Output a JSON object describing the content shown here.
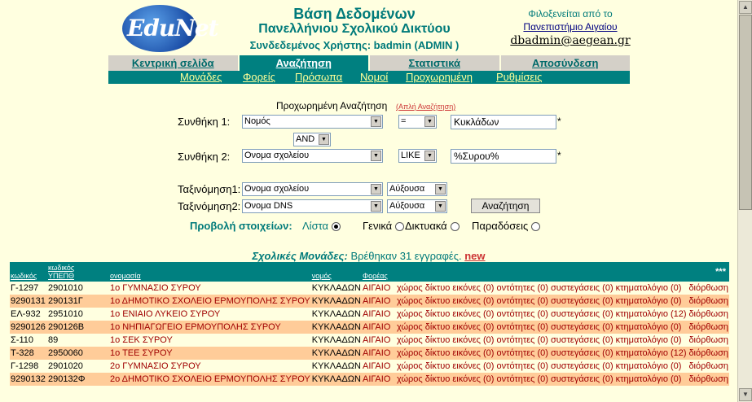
{
  "header": {
    "logo_text": "EduNet",
    "title_line1": "Βάση Δεδομένων",
    "title_line2": "Πανελλήνιου Σχολικού Δικτύου",
    "user_line": "Συνδεδεμένος Χρήστης: badmin (ADMIN )",
    "host_label": "Φιλοξενείται από το",
    "host_org": "Πανεπιστήμιο Αιγαίου",
    "host_email": "dbadmin@aegean.gr"
  },
  "nav": {
    "tabs": [
      "Κεντρική σελίδα",
      "Αναζήτηση",
      "Στατιστικά",
      "Αποσύνδεση"
    ],
    "subitems": [
      "Μονάδες",
      "Φορείς",
      "Πρόσωπα",
      "Νομοί",
      "Προχωρημένη",
      "Ρυθμίσεις"
    ]
  },
  "search": {
    "title": "Προχωρημένη Αναζήτηση",
    "simple_link": "(Απλή Αναζήτηση)",
    "cond1_label": "Συνθήκη 1:",
    "cond1_field": "Νομός",
    "cond1_op": "=",
    "cond1_value": "Κυκλάδων",
    "joiner": "AND",
    "cond2_label": "Συνθήκη 2:",
    "cond2_field": "Ονομα σχολείου",
    "cond2_op": "LIKE",
    "cond2_value": "%Συρου%",
    "star": "*",
    "sort1_label": "Ταξινόμηση1:",
    "sort1_field": "Ονομα σχολείου",
    "sort1_dir": "Αύξουσα",
    "sort2_label": "Ταξινόμηση2:",
    "sort2_field": "Ονομα DNS",
    "sort2_dir": "Αύξουσα",
    "button": "Αναζήτηση",
    "view_label": "Προβολή στοιχείων:",
    "view_options": [
      "Λίστα",
      "Γενικά",
      "Δικτυακά",
      "Παραδόσεις"
    ],
    "view_selected": "Λίστα"
  },
  "results": {
    "title": "Σχολικές Μονάδες:",
    "count_text": "Βρέθηκαν 31 εγγραφές.",
    "new_link": "new"
  },
  "table": {
    "headers": {
      "code": "κωδικός",
      "ypepth_line1": "κωδικός",
      "ypepth_line2": "ΥΠΕΠΘ",
      "name": "ονομασία",
      "nomos": "νομός",
      "foreas": "Φορέας",
      "stars": "***"
    },
    "rows": [
      {
        "code": "Γ-1297",
        "ypepth": "2901010",
        "name": "1ο ΓΥΜΝΑΣΙΟ ΣΥΡΟΥ",
        "nomos": "ΚΥΚΛΑΔΩΝ",
        "foreas": "ΑΙΓΑΙΟ",
        "links": "χώρος δίκτυο εικόνες (0) οντότητες (0) συστεγάσεις (0) κτηματολόγιο (0)",
        "edit": "διόρθωση"
      },
      {
        "code": "9290131",
        "ypepth": "290131Γ",
        "name": "1ο ΔΗΜΟΤΙΚΟ ΣΧΟΛΕΙΟ ΕΡΜΟΥΠΟΛΗΣ ΣΥΡΟΥ",
        "nomos": "ΚΥΚΛΑΔΩΝ",
        "foreas": "ΑΙΓΑΙΟ",
        "links": "χώρος δίκτυο εικόνες (0) οντότητες (0) συστεγάσεις (0) κτηματολόγιο (0)",
        "edit": "διόρθωση"
      },
      {
        "code": "ΕΛ-932",
        "ypepth": "2951010",
        "name": "1ο ΕΝΙΑΙΟ ΛΥΚΕΙΟ ΣΥΡΟΥ",
        "nomos": "ΚΥΚΛΑΔΩΝ",
        "foreas": "ΑΙΓΑΙΟ",
        "links": "χώρος δίκτυο εικόνες (0) οντότητες (0) συστεγάσεις (0) κτηματολόγιο (12)",
        "edit": "διόρθωση"
      },
      {
        "code": "9290126",
        "ypepth": "290126Β",
        "name": "1ο ΝΗΠΙΑΓΩΓΕΙΟ ΕΡΜΟΥΠΟΛΗΣ ΣΥΡΟΥ",
        "nomos": "ΚΥΚΛΑΔΩΝ",
        "foreas": "ΑΙΓΑΙΟ",
        "links": "χώρος δίκτυο εικόνες (0) οντότητες (0) συστεγάσεις (0) κτηματολόγιο (0)",
        "edit": "διόρθωση"
      },
      {
        "code": "Σ-110",
        "ypepth": "89",
        "name": "1ο ΣΕΚ ΣΥΡΟΥ",
        "nomos": "ΚΥΚΛΑΔΩΝ",
        "foreas": "ΑΙΓΑΙΟ",
        "links": "χώρος δίκτυο εικόνες (0) οντότητες (0) συστεγάσεις (0) κτηματολόγιο (0)",
        "edit": "διόρθωση"
      },
      {
        "code": "Τ-328",
        "ypepth": "2950060",
        "name": "1ο ΤΕΕ ΣΥΡΟΥ",
        "nomos": "ΚΥΚΛΑΔΩΝ",
        "foreas": "ΑΙΓΑΙΟ",
        "links": "χώρος δίκτυο εικόνες (0) οντότητες (0) συστεγάσεις (0) κτηματολόγιο (12)",
        "edit": "διόρθωση"
      },
      {
        "code": "Γ-1298",
        "ypepth": "2901020",
        "name": "2ο ΓΥΜΝΑΣΙΟ ΣΥΡΟΥ",
        "nomos": "ΚΥΚΛΑΔΩΝ",
        "foreas": "ΑΙΓΑΙΟ",
        "links": "χώρος δίκτυο εικόνες (0) οντότητες (0) συστεγάσεις (0) κτηματολόγιο (0)",
        "edit": "διόρθωση"
      },
      {
        "code": "9290132",
        "ypepth": "290132Φ",
        "name": "2ο ΔΗΜΟΤΙΚΟ ΣΧΟΛΕΙΟ ΕΡΜΟΥΠΟΛΗΣ ΣΥΡΟΥ",
        "nomos": "ΚΥΚΛΑΔΩΝ",
        "foreas": "ΑΙΓΑΙΟ",
        "links": "χώρος δίκτυο εικόνες (0) οντότητες (0) συστεγάσεις (0) κτηματολόγιο (0)",
        "edit": "διόρθωση"
      }
    ]
  }
}
